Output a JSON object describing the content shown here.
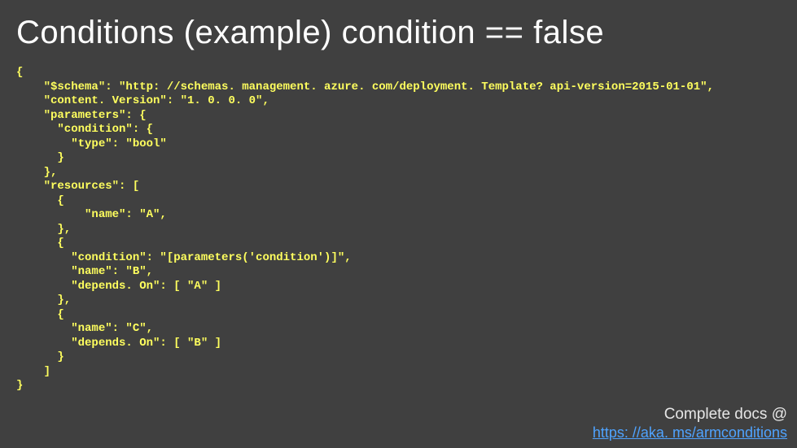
{
  "title": "Conditions  (example) condition == false",
  "code": "{\n    \"$schema\": \"http: //schemas. management. azure. com/deployment. Template? api-version=2015-01-01\",\n    \"content. Version\": \"1. 0. 0. 0\",\n    \"parameters\": {\n      \"condition\": {\n        \"type\": \"bool\"\n      }\n    },\n    \"resources\": [\n      {\n          \"name\": \"A\",\n      },\n      {\n        \"condition\": \"[parameters('condition')]\",\n        \"name\": \"B\",\n        \"depends. On\": [ \"A\" ]\n      },\n      {\n        \"name\": \"C\",\n        \"depends. On\": [ \"B\" ]\n      }\n    ]\n}",
  "footer": {
    "label": "Complete docs @",
    "link_text": "https: //aka. ms/armconditions",
    "link_href": "https://aka.ms/armconditions"
  }
}
